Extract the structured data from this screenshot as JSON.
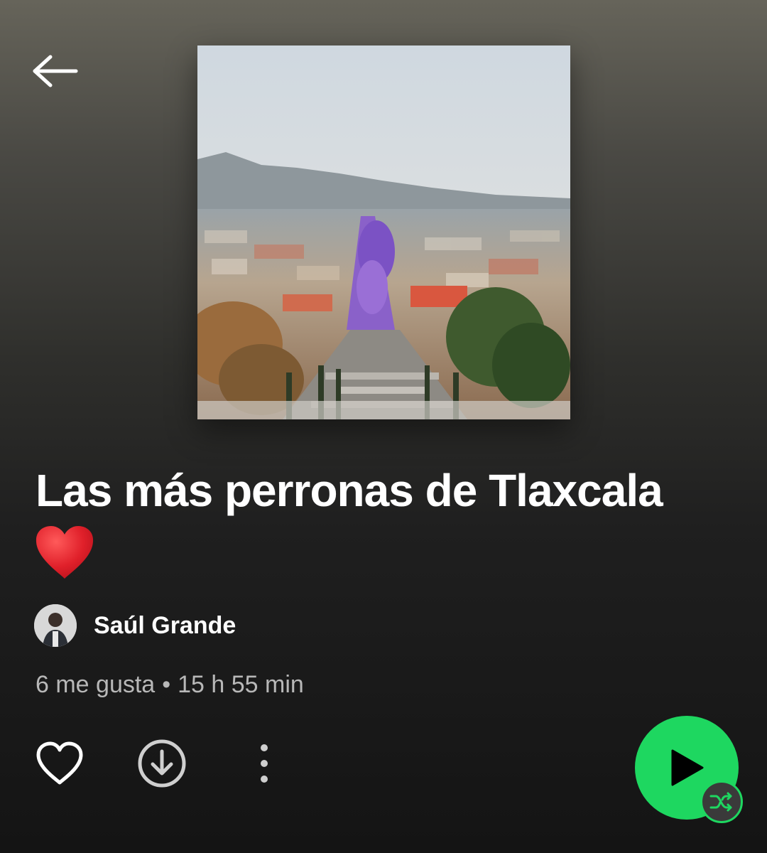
{
  "playlist": {
    "title": "Las más perronas de Tlaxcala",
    "title_emoji": "heart-emoji",
    "cover_image": "city-street-purple-jacaranda-trees-photo"
  },
  "owner": {
    "name": "Saúl Grande",
    "avatar": "user-avatar-photo"
  },
  "meta": {
    "likes": "6 me gusta",
    "separator": "•",
    "duration": "15 h 55 min"
  },
  "actions": {
    "back_icon": "arrow-left-icon",
    "like_icon": "heart-outline-icon",
    "download_icon": "download-circle-icon",
    "more_icon": "more-vertical-icon",
    "play_icon": "play-icon",
    "shuffle_icon": "shuffle-icon"
  },
  "colors": {
    "accent": "#1ed760",
    "meta_text": "#b8b8b8",
    "heart_red": "#e0202a"
  }
}
